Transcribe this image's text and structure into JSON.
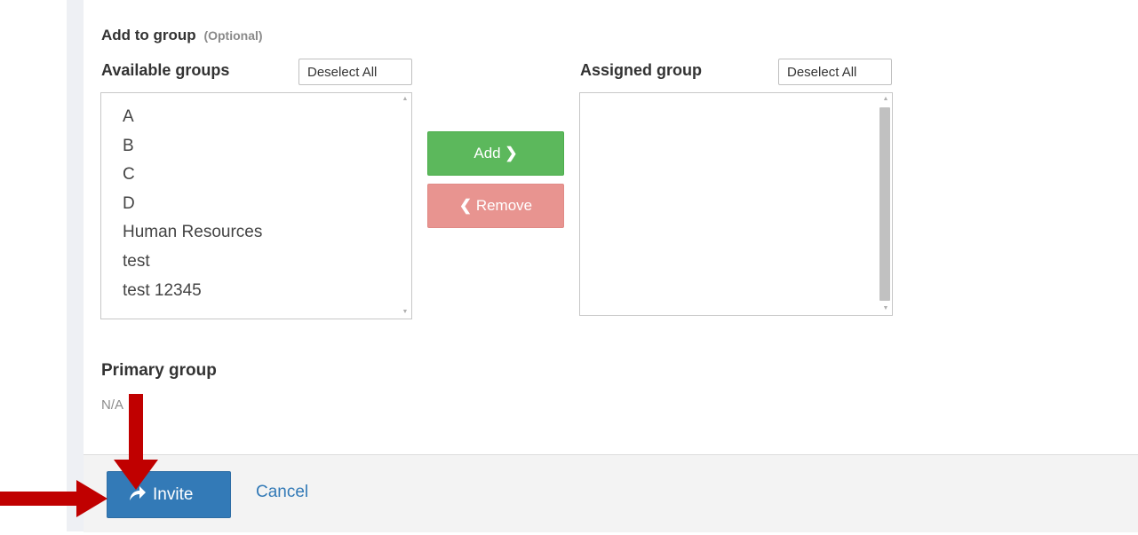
{
  "section": {
    "title": "Add to group",
    "optional": "(Optional)"
  },
  "available": {
    "label": "Available groups",
    "deselect_label": "Deselect All",
    "items": [
      "A",
      "B",
      "C",
      "D",
      "Human Resources",
      "test",
      "test 12345"
    ]
  },
  "assigned": {
    "label": "Assigned group",
    "deselect_label": "Deselect All",
    "items": []
  },
  "actions": {
    "add_label": "Add",
    "remove_label": "Remove"
  },
  "primary": {
    "label": "Primary group",
    "value": "N/A"
  },
  "footer": {
    "invite_label": "Invite",
    "cancel_label": "Cancel"
  },
  "colors": {
    "add": "#5cb85c",
    "remove": "#e89490",
    "invite": "#337ab7",
    "annotation_arrow": "#c00000"
  },
  "icons": {
    "add": "chevron-right-icon",
    "remove": "chevron-left-icon",
    "invite": "share-arrow-icon"
  }
}
